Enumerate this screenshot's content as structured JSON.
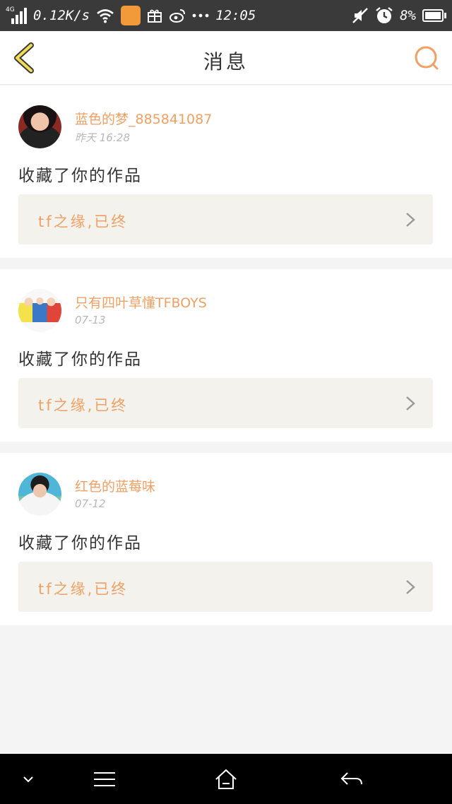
{
  "statusbar": {
    "network_label": "4G",
    "speed": "0.12K/s",
    "time": "12:05",
    "battery": "8%"
  },
  "header": {
    "title": "消息"
  },
  "messages": [
    {
      "username": "蓝色的梦_885841087",
      "time": "昨天 16:28",
      "action": "收藏了你的作品",
      "work_title": "tf之缘,已终"
    },
    {
      "username": "只有四叶草懂TFBOYS",
      "time": "07-13",
      "action": "收藏了你的作品",
      "work_title": "tf之缘,已终"
    },
    {
      "username": "红色的蓝莓味",
      "time": "07-12",
      "action": "收藏了你的作品",
      "work_title": "tf之缘,已终"
    }
  ],
  "colors": {
    "accent": "#f0a064",
    "statusbar_bg": "#3a3a3a",
    "card_bg": "#ffffff",
    "work_bg": "#f3f2ec",
    "page_bg": "#f4f4f4"
  },
  "icons": [
    "signal-icon",
    "wifi-icon",
    "app-icon",
    "gift-icon",
    "weibo-icon",
    "more-icon",
    "mute-icon",
    "alarm-icon",
    "battery-icon",
    "back-icon",
    "search-icon",
    "chevron-right-icon",
    "nav-down-icon",
    "nav-menu-icon",
    "nav-home-icon",
    "nav-back-icon"
  ]
}
